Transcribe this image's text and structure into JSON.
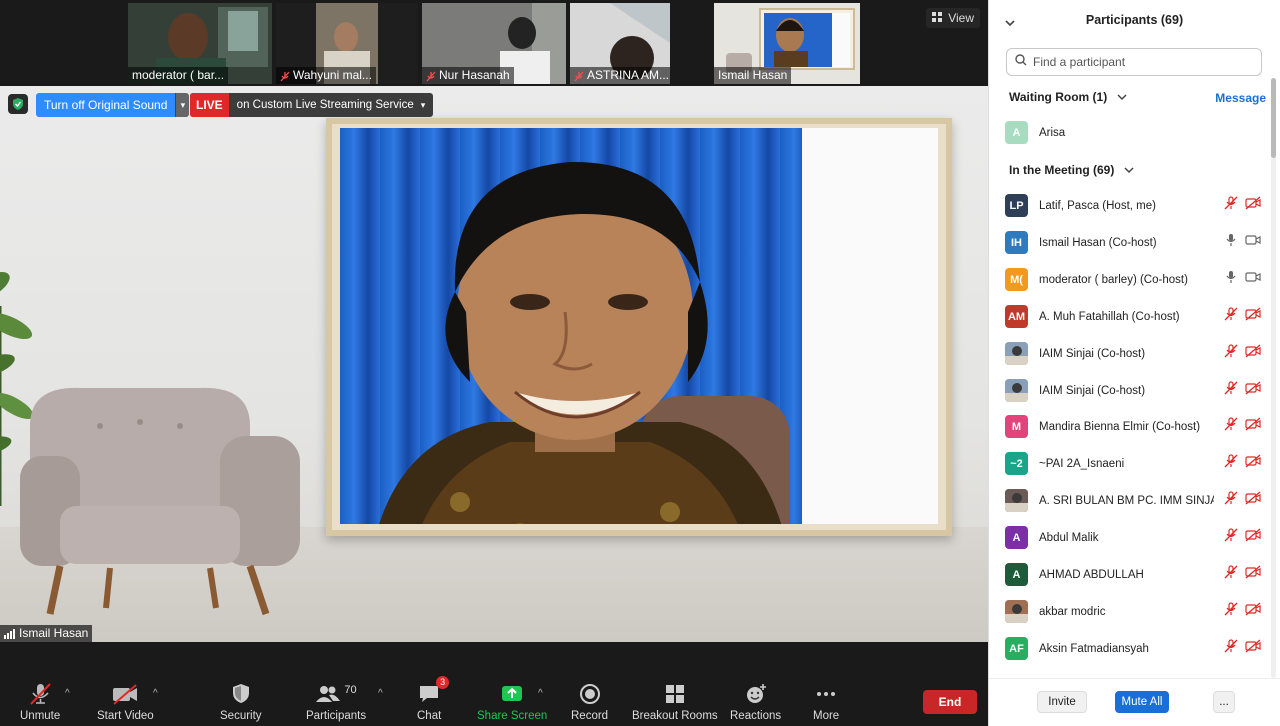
{
  "thumbnails": [
    {
      "name": "moderator ( bar...",
      "muted": false
    },
    {
      "name": "Wahyuni mal...",
      "muted": true
    },
    {
      "name": "Nur Hasanah",
      "muted": true
    },
    {
      "name": "ASTRINA AM...",
      "muted": true
    },
    {
      "name": "Ismail Hasan",
      "muted": false,
      "active": true
    }
  ],
  "view_label": "View",
  "overlay": {
    "original_sound_label": "Turn off Original Sound",
    "live_label": "LIVE",
    "streaming_label": "on Custom Live Streaming Service"
  },
  "speaker_name": "Ismail Hasan",
  "toolbar": {
    "unmute": "Unmute",
    "start_video": "Start Video",
    "security": "Security",
    "participants": "Participants",
    "participants_count": "70",
    "chat": "Chat",
    "chat_badge": "3",
    "share_screen": "Share Screen",
    "record": "Record",
    "breakout_rooms": "Breakout Rooms",
    "reactions": "Reactions",
    "more": "More",
    "end": "End"
  },
  "panel": {
    "title": "Participants (69)",
    "search_placeholder": "Find a participant",
    "waiting_room_label": "Waiting Room (1)",
    "message_label": "Message",
    "waiting": [
      {
        "initials": "A",
        "name": "Arisa",
        "color": "#a8dcc0"
      }
    ],
    "in_meeting_label": "In the Meeting (69)",
    "participants": [
      {
        "initials": "LP",
        "name": "Latif, Pasca (Host, me)",
        "color": "#2f3f57",
        "mic": "muted",
        "cam": "off"
      },
      {
        "initials": "IH",
        "name": "Ismail Hasan (Co-host)",
        "color": "#2d7bbf",
        "mic": "on",
        "cam": "on"
      },
      {
        "initials": "M(",
        "name": "moderator ( barley) (Co-host)",
        "color": "#f29a1f",
        "mic": "on",
        "cam": "on"
      },
      {
        "initials": "AM",
        "name": "A. Muh Fatahillah (Co-host)",
        "color": "#c0392b",
        "mic": "muted",
        "cam": "off"
      },
      {
        "initials": "",
        "name": "IAIM Sinjai (Co-host)",
        "color": "#8aa0b8",
        "mic": "muted",
        "cam": "off",
        "photo": true
      },
      {
        "initials": "",
        "name": "IAIM Sinjai (Co-host)",
        "color": "#8aa0b8",
        "mic": "muted",
        "cam": "off",
        "photo": true
      },
      {
        "initials": "M",
        "name": "Mandira Bienna Elmir (Co-host)",
        "color": "#e0447a",
        "mic": "muted",
        "cam": "off"
      },
      {
        "initials": "~2",
        "name": "~PAI 2A_Isnaeni",
        "color": "#18a589",
        "mic": "muted",
        "cam": "off"
      },
      {
        "initials": "",
        "name": "A. SRI BULAN BM PC. IMM SINJAI",
        "color": "#6b5a55",
        "mic": "muted",
        "cam": "off",
        "photo": true
      },
      {
        "initials": "A",
        "name": "Abdul Malik",
        "color": "#7b2fa6",
        "mic": "muted",
        "cam": "off"
      },
      {
        "initials": "A",
        "name": "AHMAD ABDULLAH",
        "color": "#1d5c3a",
        "mic": "muted",
        "cam": "off"
      },
      {
        "initials": "",
        "name": "akbar modric",
        "color": "#a07055",
        "mic": "muted",
        "cam": "off",
        "photo": true
      },
      {
        "initials": "AF",
        "name": "Aksin Fatmadiansyah",
        "color": "#27ae60",
        "mic": "muted",
        "cam": "off"
      }
    ],
    "invite_label": "Invite",
    "mute_all_label": "Mute All",
    "more_label": "..."
  }
}
